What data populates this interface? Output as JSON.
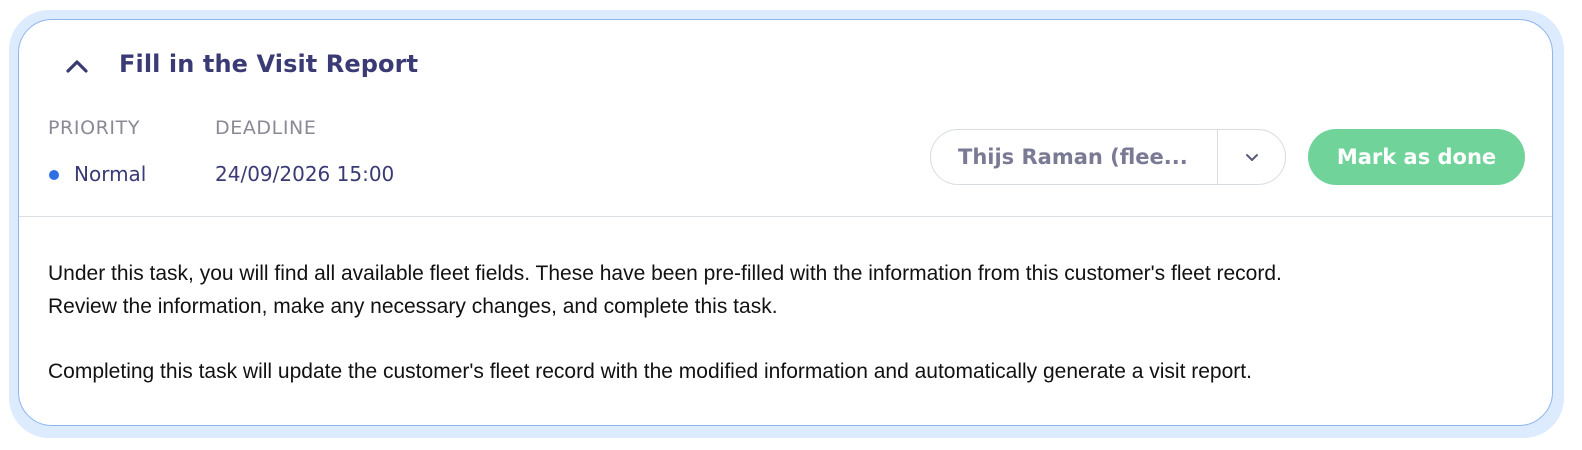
{
  "task": {
    "title": "Fill in the Visit Report",
    "collapse_icon": "chevron-up-icon"
  },
  "meta": {
    "priority_label": "PRIORITY",
    "priority_value": "Normal",
    "priority_color": "#2f6fe4",
    "deadline_label": "DEADLINE",
    "deadline_value": "24/09/2026 15:00"
  },
  "assignee": {
    "name": "Thijs Raman (flee...",
    "dropdown_icon": "chevron-down-icon"
  },
  "actions": {
    "mark_done_label": "Mark as done",
    "mark_done_color": "#6fd39a"
  },
  "description": {
    "line1": "Under this task, you will find all available fleet fields. These have been pre-filled with the information from this customer's fleet record.",
    "line2": "Review the information, make any necessary changes, and complete this task.",
    "paragraph2": "Completing this task will update the customer's fleet record with the modified information and automatically generate a visit report."
  }
}
